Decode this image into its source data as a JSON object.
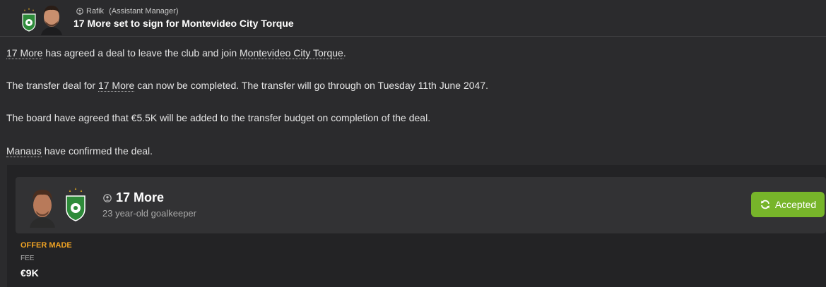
{
  "header": {
    "sender_name": "Rafik",
    "sender_role": "(Assistant Manager)",
    "subject": "17 More set to sign for Montevideo City Torque"
  },
  "message": {
    "p1": {
      "player": "17 More",
      "mid": " has agreed a deal to leave the club and join ",
      "club": "Montevideo City Torque",
      "end": "."
    },
    "p2": {
      "start": "The transfer deal for ",
      "player": "17 More",
      "end": " can now be completed. The transfer will go through on Tuesday 11th June 2047."
    },
    "p3": "The board have agreed that €5.5K will be added to the transfer budget on completion of the deal.",
    "p4": {
      "club": "Manaus",
      "end": " have confirmed the deal."
    }
  },
  "player_card": {
    "name": "17 More",
    "description": "23 year-old goalkeeper",
    "status_button": "Accepted"
  },
  "offer": {
    "title": "OFFER MADE",
    "fee_label": "FEE",
    "fee_value": "€9K"
  },
  "colors": {
    "background": "#2b2b2d",
    "accent_green": "#77b52a",
    "offer_orange": "#f0a323"
  }
}
